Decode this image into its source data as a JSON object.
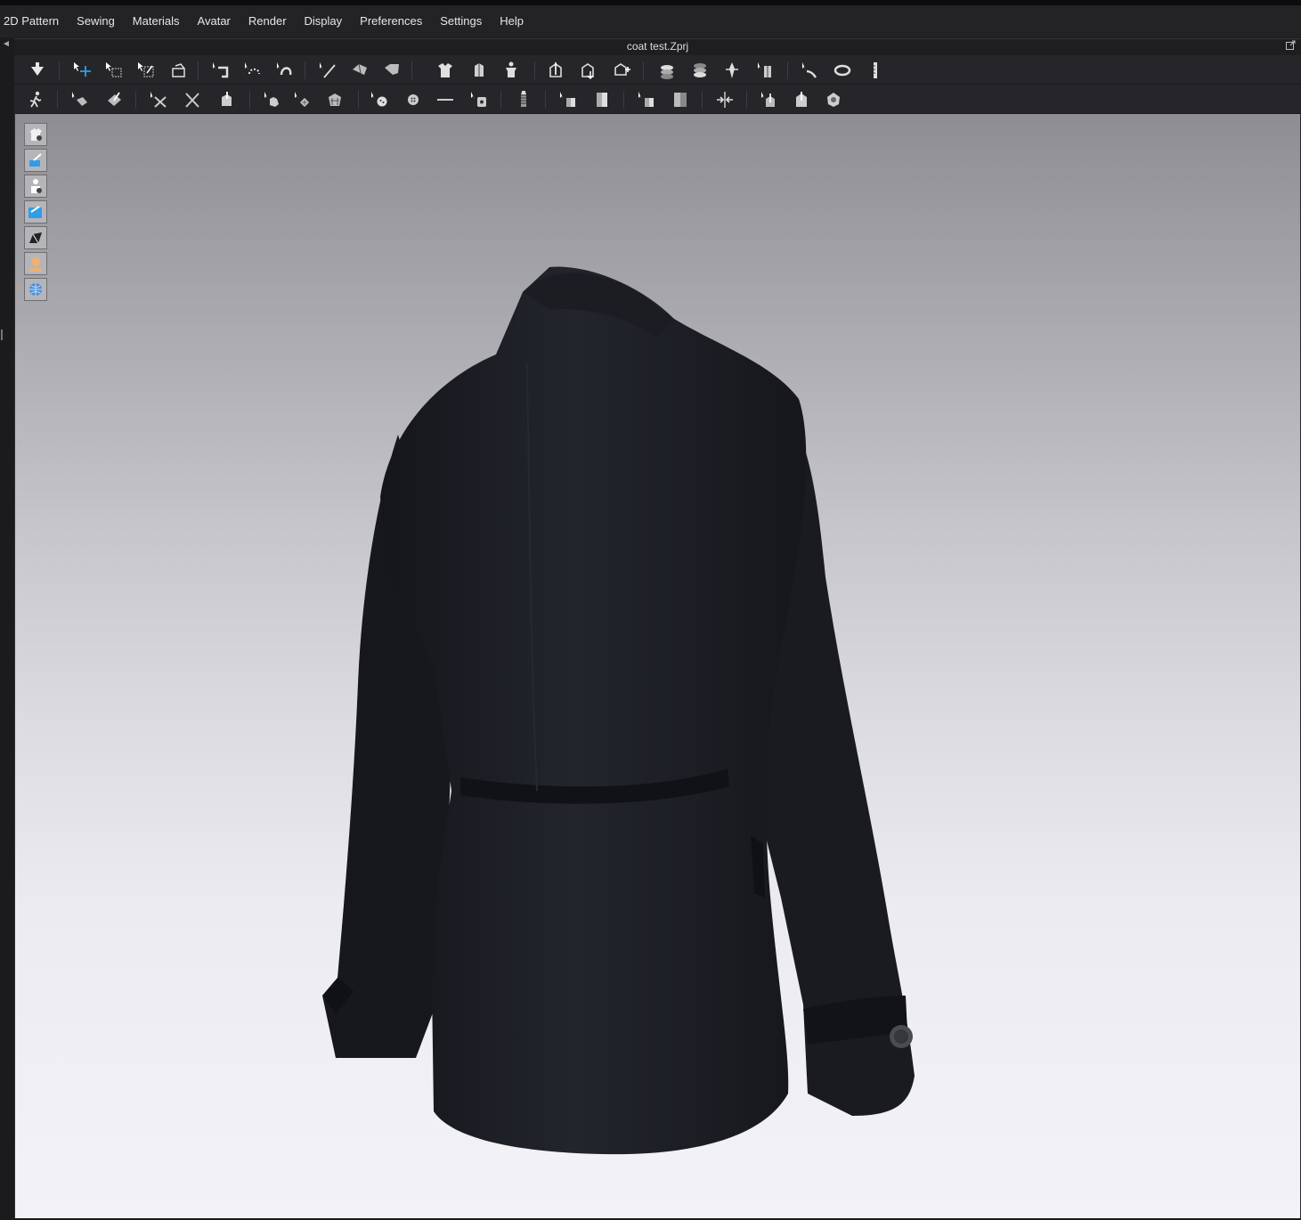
{
  "menu": {
    "items": [
      "2D Pattern",
      "Sewing",
      "Materials",
      "Avatar",
      "Render",
      "Display",
      "Preferences",
      "Settings",
      "Help"
    ]
  },
  "window": {
    "title": "coat test.Zprj"
  },
  "toolbar_row1": {
    "icons": [
      "simulation-icon",
      "select-move-icon",
      "select-mesh-box-icon",
      "select-mesh-brush-icon",
      "fold-arrangement-icon",
      "tack-icon",
      "tack-on-avatar-icon",
      "tack-two-points-icon",
      "edit-sewing-icon",
      "segment-sewing-icon",
      "free-sewing-icon",
      "arrangement-point-icon",
      "arrangement-bounding-icon",
      "show-avatar-icon",
      "pin-icon",
      "pin-box-icon",
      "pin-on-avatar-icon",
      "layer-up-icon",
      "layer-down-icon",
      "fold-rotate-icon",
      "steam-icon",
      "tape-icon",
      "measure-circumference-icon",
      "ruler-icon"
    ]
  },
  "toolbar_row2": {
    "icons": [
      "walk-icon",
      "edit-texture-icon",
      "transform-texture-icon",
      "edit-graphic-icon",
      "transform-graphic-icon",
      "brush-icon",
      "add-pocket-icon",
      "quilting-icon",
      "smocking-icon",
      "button-icon",
      "buttonhole-icon",
      "select-button-icon",
      "zipper-icon",
      "zipper-slider-icon",
      "puckering-icon",
      "piping-icon",
      "trim-icon",
      "select-trim-icon",
      "shrink-icon",
      "fold-icon",
      "garment-fit-icon",
      "fitting-suit-icon",
      "reset-icon"
    ]
  },
  "viewport_tools": {
    "icons": [
      "garment-view-icon",
      "avatar-surface-icon",
      "avatar-view-icon",
      "texture-view-icon",
      "normal-map-icon",
      "skin-view-icon",
      "environment-view-icon"
    ]
  },
  "colors": {
    "menubar": "#232326",
    "toolbar": "#26262a",
    "accent_select": "#2f9ee8",
    "garment": "#1f2127"
  }
}
